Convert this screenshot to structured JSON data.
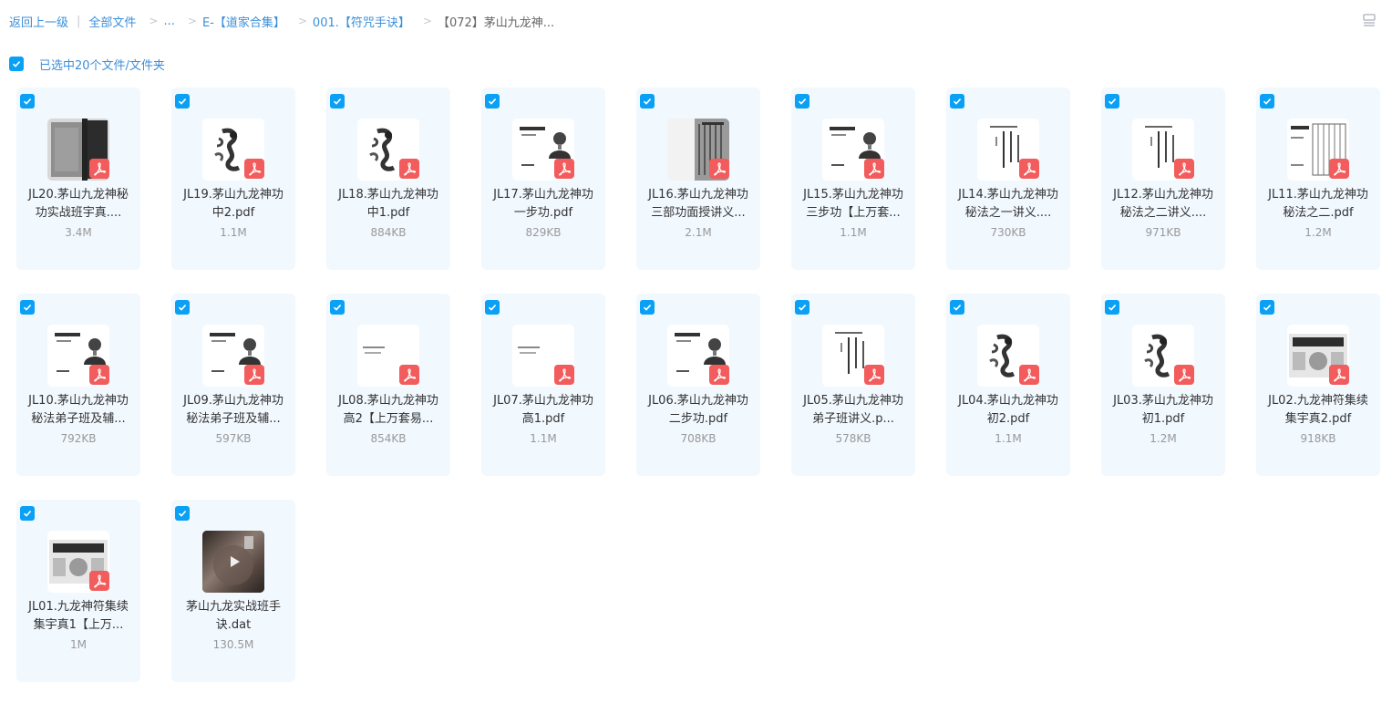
{
  "breadcrumb": {
    "back": "返回上一级",
    "all_files": "全部文件",
    "ellipsis": "...",
    "level1": "E-【道家合集】",
    "level2": "001.【符咒手诀】",
    "current": "【072】茅山九龙神..."
  },
  "selection": {
    "label": "已选中20个文件/文件夹"
  },
  "accent_color": "#0aa0f5",
  "files": [
    {
      "line1": "JL20.茅山九龙神秘",
      "line2": "功实战班宇真....",
      "size": "3.4M",
      "type": "pdf",
      "thumb": "dark-scan"
    },
    {
      "line1": "JL19.茅山九龙神功",
      "line2": "中2.pdf",
      "size": "1.1M",
      "type": "pdf",
      "thumb": "dragon"
    },
    {
      "line1": "JL18.茅山九龙神功",
      "line2": "中1.pdf",
      "size": "884KB",
      "type": "pdf",
      "thumb": "dragon"
    },
    {
      "line1": "JL17.茅山九龙神功",
      "line2": "一步功.pdf",
      "size": "829KB",
      "type": "pdf",
      "thumb": "portrait"
    },
    {
      "line1": "JL16.茅山九龙神功",
      "line2": "三部功面授讲义...",
      "size": "2.1M",
      "type": "pdf",
      "thumb": "columns"
    },
    {
      "line1": "JL15.茅山九龙神功",
      "line2": "三步功【上万套...",
      "size": "1.1M",
      "type": "pdf",
      "thumb": "portrait"
    },
    {
      "line1": "JL14.茅山九龙神功",
      "line2": "秘法之一讲义....",
      "size": "730KB",
      "type": "pdf",
      "thumb": "text"
    },
    {
      "line1": "JL12.茅山九龙神功",
      "line2": "秘法之二讲义....",
      "size": "971KB",
      "type": "pdf",
      "thumb": "text"
    },
    {
      "line1": "JL11.茅山九龙神功",
      "line2": "秘法之二.pdf",
      "size": "1.2M",
      "type": "pdf",
      "thumb": "table"
    },
    {
      "line1": "JL10.茅山九龙神功",
      "line2": "秘法弟子班及辅...",
      "size": "792KB",
      "type": "pdf",
      "thumb": "portrait"
    },
    {
      "line1": "JL09.茅山九龙神功",
      "line2": "秘法弟子班及辅...",
      "size": "597KB",
      "type": "pdf",
      "thumb": "portrait"
    },
    {
      "line1": "JL08.茅山九龙神功",
      "line2": "高2【上万套易...",
      "size": "854KB",
      "type": "pdf",
      "thumb": "blank"
    },
    {
      "line1": "JL07.茅山九龙神功",
      "line2": "高1.pdf",
      "size": "1.1M",
      "type": "pdf",
      "thumb": "blank"
    },
    {
      "line1": "JL06.茅山九龙神功",
      "line2": "二步功.pdf",
      "size": "708KB",
      "type": "pdf",
      "thumb": "portrait"
    },
    {
      "line1": "JL05.茅山九龙神功",
      "line2": "弟子班讲义.p...",
      "size": "578KB",
      "type": "pdf",
      "thumb": "text"
    },
    {
      "line1": "JL04.茅山九龙神功",
      "line2": "初2.pdf",
      "size": "1.1M",
      "type": "pdf",
      "thumb": "dragon"
    },
    {
      "line1": "JL03.茅山九龙神功",
      "line2": "初1.pdf",
      "size": "1.2M",
      "type": "pdf",
      "thumb": "dragon"
    },
    {
      "line1": "JL02.九龙神符集续",
      "line2": "集宇真2.pdf",
      "size": "918KB",
      "type": "pdf",
      "thumb": "cover"
    },
    {
      "line1": "JL01.九龙神符集续",
      "line2": "集宇真1【上万...",
      "size": "1M",
      "type": "pdf",
      "thumb": "cover"
    },
    {
      "line1": "茅山九龙实战班手",
      "line2": "诀.dat",
      "size": "130.5M",
      "type": "video",
      "thumb": "video"
    }
  ]
}
